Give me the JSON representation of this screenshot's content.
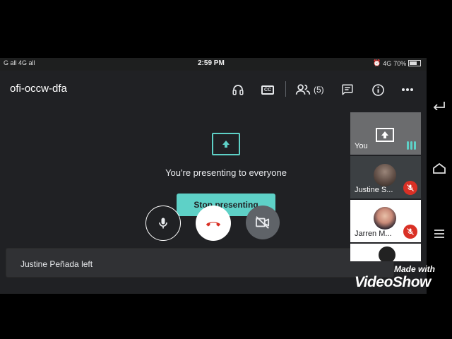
{
  "status_bar": {
    "left_text": "G all 4G all",
    "time": "2:59 PM",
    "network": "4G",
    "battery": "70%"
  },
  "meeting": {
    "code": "ofi-occw-dfa",
    "participant_count": "(5)",
    "cc_label": "CC"
  },
  "presenting": {
    "message": "You're presenting to everyone",
    "stop_label": "Stop presenting"
  },
  "participants": [
    {
      "name": "You",
      "muted": false
    },
    {
      "name": "Justine S...",
      "muted": true
    },
    {
      "name": "Jarren M...",
      "muted": true
    }
  ],
  "snackbar": {
    "text": "Justine Peñada left"
  },
  "watermark": {
    "made_with": "Made with",
    "brand": "VideoShow"
  },
  "colors": {
    "accent": "#5ed1c7",
    "background": "#202124",
    "danger": "#d93025"
  }
}
